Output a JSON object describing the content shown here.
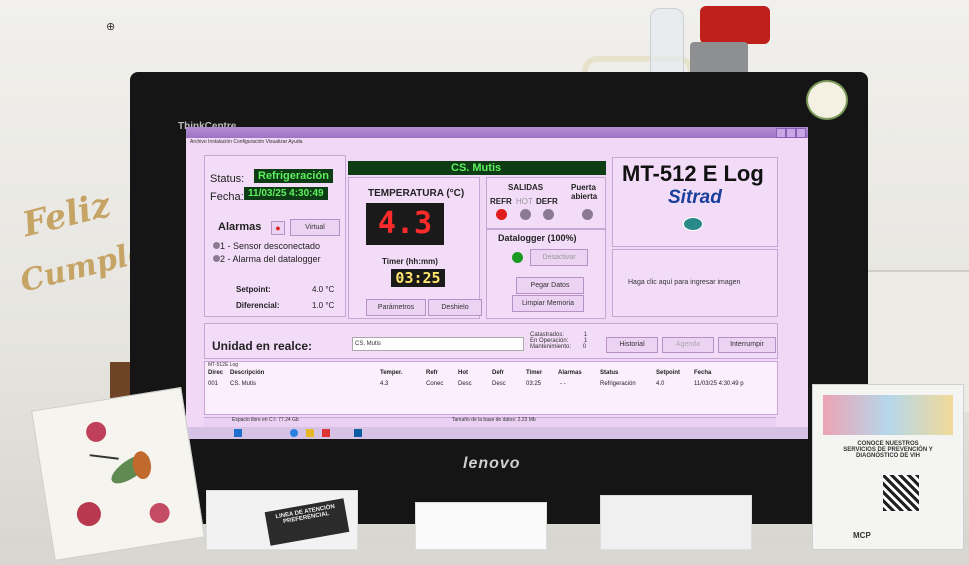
{
  "scene": {
    "monitor_brand": "ThinkCentre",
    "monitor_logo": "lenovo",
    "party_topper_line1": "Feliz",
    "party_topper_line2": "Cumpleaños"
  },
  "app": {
    "menu": "Archivo  Instalación  Configuración  Visualizar  Ayuda",
    "unit_name": "CS. Mutis",
    "status_label": "Status:",
    "status_value": "Refrigeración",
    "date_label": "Fecha:",
    "date_value": "11/03/25 4:30:49",
    "alarms_label": "Alarmas",
    "alarm_virtual_button": "Virtual",
    "alarms": [
      "1 - Sensor desconectado",
      "2 - Alarma del datalogger"
    ],
    "setpoint_label": "Setpoint:",
    "setpoint_value": "4.0 °C",
    "differential_label": "Diferencial:",
    "differential_value": "1.0 °C",
    "temperature_label": "TEMPERATURA (°C)",
    "temperature_value": "4.3",
    "timer_label": "Timer (hh:mm)",
    "timer_value": "03:25",
    "parameters_button": "Parámetros",
    "defrost_button": "Deshielo",
    "outputs_label": "SALIDAS",
    "outputs": [
      "REFR",
      "HOT",
      "DEFR"
    ],
    "door_label": "Puerta abierta",
    "datalogger_label": "Datalogger (100%)",
    "deactivate_button": "Desactivar",
    "paste_data_button": "Pegar Datos",
    "clear_memory_button": "Limpiar Memoria",
    "model": "MT-512 E Log",
    "brand": "Sitrad",
    "image_hint": "Haga clic aquí para ingresar imagen",
    "highlight_label": "Unidad en realce:",
    "highlight_value": "CS. Mutis",
    "stats": [
      {
        "label": "Catastrados:",
        "value": "1"
      },
      {
        "label": "En Operación:",
        "value": "1"
      },
      {
        "label": "Mantenimiento:",
        "value": "0"
      }
    ],
    "history_button": "Historial",
    "agenda_button": "Agenda",
    "interrupt_button": "Interrumpir",
    "table_title": "MT-512E Log",
    "table_headers": [
      "Direc",
      "Descripción",
      "Temper.",
      "Refr",
      "Hot",
      "Defr",
      "Timer",
      "Alarmas",
      "Status",
      "Setpoint",
      "Fecha"
    ],
    "table_row": [
      "001",
      "CS. Mutis",
      "4.3",
      "Conec",
      "Desc",
      "Desc",
      "03:25",
      "- -",
      "Refrigeración",
      "4.0",
      "11/03/25 4:30:49 p"
    ],
    "footer_left": "Espacio libre en C:\\: 77.24 Gb",
    "footer_mid": "Tamaño de la base de datos: 2.23 Mb",
    "colors": {
      "accent_green": "#5ff060",
      "led_red": "#ff2a2a",
      "purple_bg": "#f0d8f6"
    }
  },
  "desk": {
    "card_right_text": "CONOCE NUESTROS SERVICIOS DE PREVENCIÓN Y DIAGNÓSTICO DE VIH",
    "card_right_footer": "MCP",
    "papers_left_label": "LINEA DE ATENCIÓN PREFERENCIAL"
  }
}
